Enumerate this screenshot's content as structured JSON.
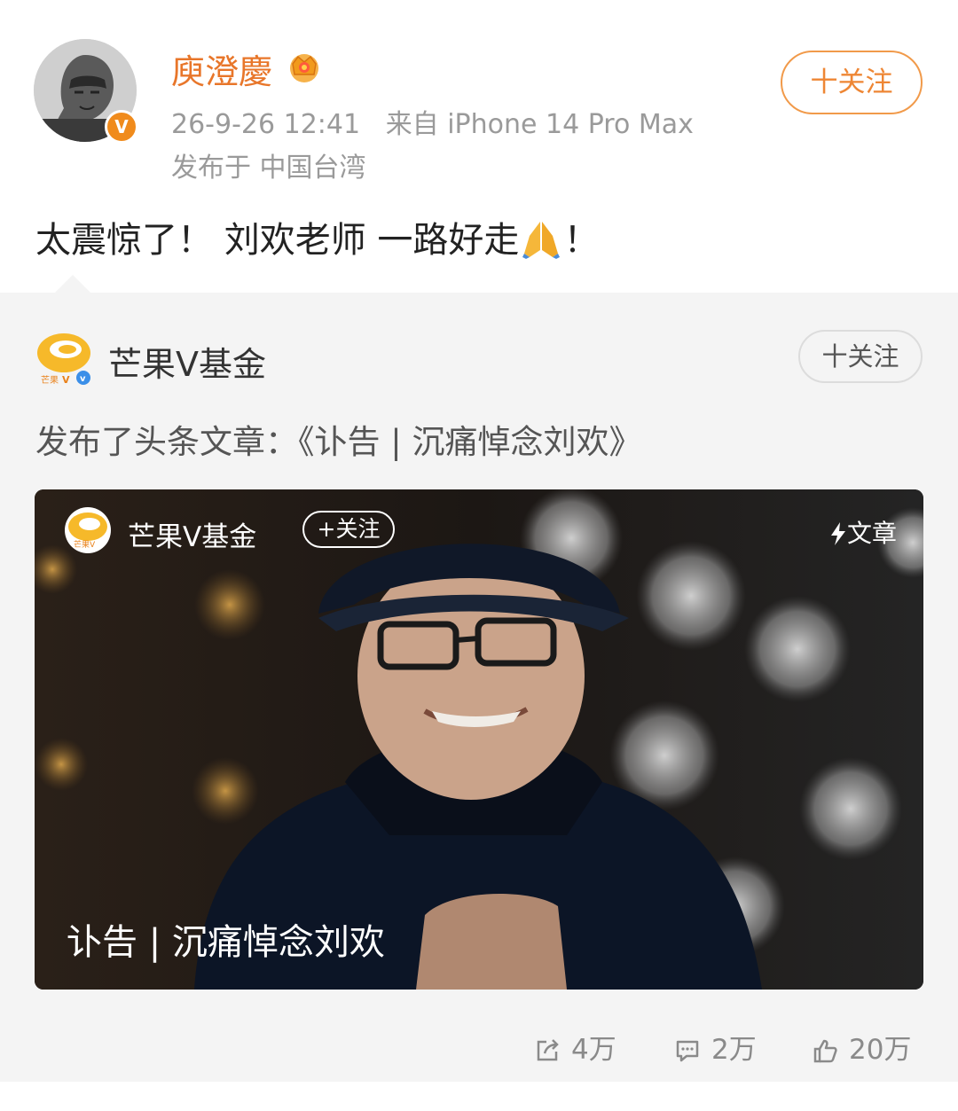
{
  "post": {
    "username": "庾澄慶",
    "verified_badge": "V",
    "timestamp": "26-9-26 12:41",
    "source": "来自 iPhone 14 Pro Max",
    "location": "发布于 中国台湾",
    "follow_label": "十关注",
    "text_before": "太震惊了！ 刘欢老师 一路好走",
    "text_after": "！",
    "emoji": "folded-hands-icon"
  },
  "repost": {
    "account_name": "芒果V基金",
    "follow_label": "十关注",
    "headline": "发布了头条文章：《讣告 | 沉痛悼念刘欢》",
    "card": {
      "account_name": "芒果V基金",
      "follow_label": "+关注",
      "type_label": "文章",
      "title": "讣告 | 沉痛悼念刘欢"
    }
  },
  "actions": {
    "shares": "4万",
    "comments": "2万",
    "likes": "20万"
  },
  "colors": {
    "accent_orange": "#e8762a",
    "meta_gray": "#9a9a9a",
    "repost_bg": "#f4f4f4"
  }
}
